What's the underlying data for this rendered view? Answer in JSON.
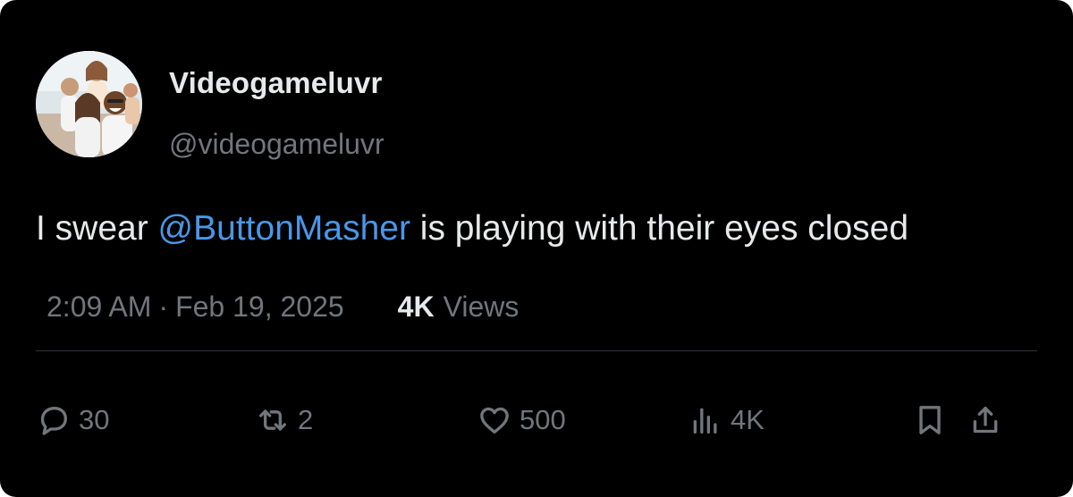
{
  "author": {
    "display_name": "Videogameluvr",
    "handle": "@videogameluvr",
    "avatar": "group-photo-avatar"
  },
  "tweet": {
    "text_before": "I swear ",
    "mention": "@ButtonMasher",
    "text_after": " is playing with their eyes closed",
    "mention_color": "#4a97e8"
  },
  "meta": {
    "time": "2:09 AM",
    "separator": "·",
    "date": "Feb 19, 2025",
    "views_count": "4K",
    "views_label": "Views"
  },
  "actions": {
    "reply": {
      "icon": "reply-icon",
      "count": "30"
    },
    "retweet": {
      "icon": "retweet-icon",
      "count": "2"
    },
    "like": {
      "icon": "heart-icon",
      "count": "500"
    },
    "views": {
      "icon": "analytics-icon",
      "count": "4K"
    },
    "bookmark": {
      "icon": "bookmark-icon"
    },
    "share": {
      "icon": "share-icon"
    }
  },
  "colors": {
    "background": "#000000",
    "primary_text": "#e7e9ea",
    "secondary_text": "#71767b",
    "link": "#4a97e8",
    "divider": "#2f3336"
  }
}
